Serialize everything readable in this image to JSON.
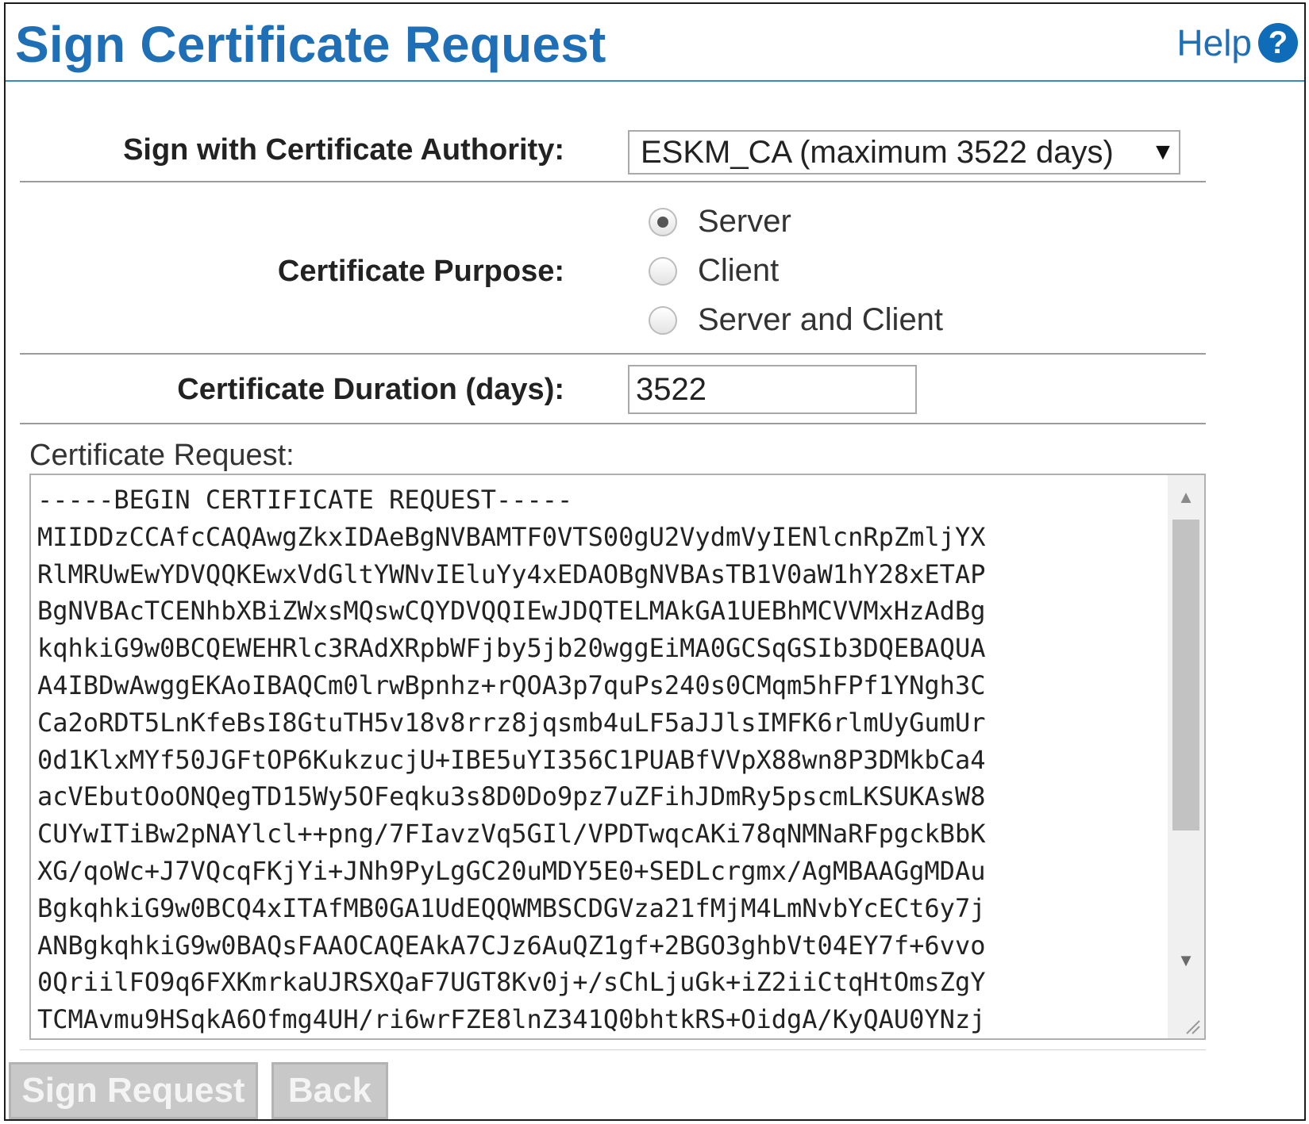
{
  "header": {
    "title": "Sign Certificate Request",
    "help_label": "Help",
    "help_icon": "?"
  },
  "form": {
    "ca_label": "Sign with Certificate Authority:",
    "ca_selected": "ESKM_CA (maximum 3522 days)",
    "purpose_label": "Certificate Purpose:",
    "purpose_options": [
      {
        "label": "Server",
        "checked": true
      },
      {
        "label": "Client",
        "checked": false
      },
      {
        "label": "Server and Client",
        "checked": false
      }
    ],
    "duration_label": "Certificate Duration (days):",
    "duration_value": "3522",
    "request_label": "Certificate Request:",
    "request_lines": [
      "-----BEGIN CERTIFICATE REQUEST-----",
      "MIIDDzCCAfcCAQAwgZkxIDAeBgNVBAMTF0VTS00gU2VydmVyIENlcnRpZmljYX",
      "RlMRUwEwYDVQQKEwxVdGltYWNvIEluYy4xEDAOBgNVBAsTB1V0aW1hY28xETAP",
      "BgNVBAcTCENhbXBiZWxsMQswCQYDVQQIEwJDQTELMAkGA1UEBhMCVVMxHzAdBg",
      "kqhkiG9w0BCQEWEHRlc3RAdXRpbWFjby5jb20wggEiMA0GCSqGSIb3DQEBAQUA",
      "A4IBDwAwggEKAoIBAQCm0lrwBpnhz+rQOA3p7quPs240s0CMqm5hFPf1YNgh3C",
      "Ca2oRDT5LnKfeBsI8GtuTH5v18v8rrz8jqsmb4uLF5aJJlsIMFK6rlmUyGumUr",
      "0d1KlxMYf50JGFtOP6KukzucjU+IBE5uYI356C1PUABfVVpX88wn8P3DMkbCa4",
      "acVEbutOoONQegTD15Wy5OFeqku3s8D0Do9pz7uZFihJDmRy5pscmLKSUKAsW8",
      "CUYwITiBw2pNAYlcl++png/7FIavzVq5GIl/VPDTwqcAKi78qNMNaRFpgckBbK",
      "XG/qoWc+J7VQcqFKjYi+JNh9PyLgGC20uMDY5E0+SEDLcrgmx/AgMBAAGgMDAu",
      "BgkqhkiG9w0BCQ4xITAfMB0GA1UdEQQWMBSCDGVza21fMjM4LmNvbYcECt6y7j",
      "ANBgkqhkiG9w0BAQsFAAOCAQEAkA7CJz6AuQZ1gf+2BGO3ghbVt04EY7f+6vvo",
      "0QriilFO9q6FXKmrkaUJRSXQaF7UGT8Kv0j+/sChLjuGk+iZ2iiCtqHtOmsZgY",
      "TCMAvmu9HSqkA6Ofmg4UH/ri6wrFZE8lnZ341Q0bhtkRS+OidgA/KyQAU0YNzj"
    ]
  },
  "buttons": {
    "sign": "Sign Request",
    "back": "Back"
  },
  "icons": {
    "select_arrow": "▼",
    "scroll_up": "▲",
    "scroll_down": "▼"
  },
  "colors": {
    "title": "#1f6fb7",
    "header_rule": "#3a88c5",
    "button_disabled": "#c8c8c8"
  }
}
